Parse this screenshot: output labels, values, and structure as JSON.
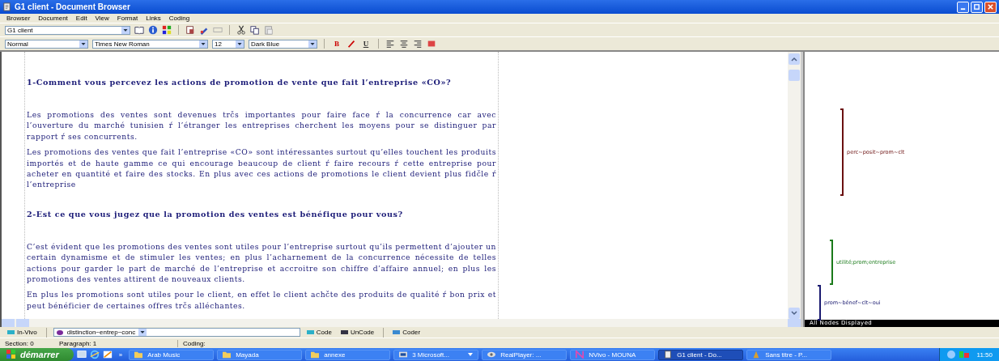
{
  "window": {
    "title": "G1 client - Document Browser"
  },
  "menu": [
    "Browser",
    "Document",
    "Edit",
    "View",
    "Format",
    "Links",
    "Coding"
  ],
  "toolbar": {
    "document": "G1 client"
  },
  "format_bar": {
    "style": "Normal",
    "font": "Times New Roman",
    "size": "12",
    "ink": "Dark Blue",
    "bold": "B",
    "underline": "U"
  },
  "document": [
    {
      "kind": "heading",
      "text": "1-Comment vous percevez les actions de promotion de vente que fait l’entreprise «CO»?"
    },
    {
      "kind": "paragraph",
      "text": "Les promotions des ventes sont devenues trčs importantes pour faire face ŕ la concurrence car avec l’ouverture du marché tunisien ŕ l’étranger les entreprises cherchent les moyens pour se distinguer par rapport ŕ ses concurrents."
    },
    {
      "kind": "paragraph",
      "text": "Les promotions des ventes que fait l’entreprise «CO» sont intéressantes surtout qu’elles touchent les produits importés et de haute gamme ce qui encourage beaucoup de client ŕ faire recours ŕ cette entreprise pour acheter en quantité et faire des stocks. En plus avec ces actions de promotions le client devient plus fidčle ŕ l’entreprise"
    },
    {
      "kind": "heading",
      "text": "2-Est ce que vous jugez que  la promotion des ventes est bénéfique pour vous?"
    },
    {
      "kind": "paragraph",
      "text": "C’est évident que les promotions des ventes sont utiles pour l’entreprise surtout qu’ils permettent d’ajouter un certain dynamisme et de stimuler les ventes; en plus l’acharnement de la concurrence nécessite de telles actions pour garder le part de marché de l’entreprise et accroitre son chiffre d’affaire annuel; en plus les promotions des ventes attirent de nouveaux clients."
    },
    {
      "kind": "paragraph",
      "text": "En plus les promotions sont utiles pour le client, en effet le client achčte des produits de qualité ŕ bon prix et peut bénéficier de certaines offres trčs alléchantes."
    }
  ],
  "coding_stripes": [
    {
      "label": "perc~posit~prom~clt",
      "color": "#6b1010"
    },
    {
      "label": "utilité;prom;entreprise",
      "color": "#1a7a1a"
    },
    {
      "label": "prom~bénef~clt~oui",
      "color": "#1a1a70"
    }
  ],
  "coding_footer": "All Nodes Displayed",
  "coding_bar": {
    "in_vivo": "In-Vivo",
    "node": "distinction~entrep~conc",
    "code": "Code",
    "uncode": "UnCode",
    "coder": "Coder"
  },
  "status_bar": {
    "section": "Section: 0",
    "paragraph": "Paragraph: 1",
    "coding": "Coding:"
  },
  "taskbar": {
    "start": "démarrer",
    "more": "»",
    "clock": "11:50",
    "items": [
      {
        "label": "Arab Music",
        "kind": "folder",
        "selected": false
      },
      {
        "label": "Mayada",
        "kind": "folder",
        "selected": false
      },
      {
        "label": "annexe",
        "kind": "folder",
        "selected": false
      },
      {
        "label": "3 Microsoft...",
        "kind": "group",
        "selected": false
      },
      {
        "label": "RealPlayer: ...",
        "kind": "player",
        "selected": false
      },
      {
        "label": "NVivo - MOUNA",
        "kind": "nvivo",
        "selected": false
      },
      {
        "label": "G1 client - Do...",
        "kind": "doc",
        "selected": true
      },
      {
        "label": "Sans titre - P...",
        "kind": "paint",
        "selected": false
      }
    ]
  }
}
